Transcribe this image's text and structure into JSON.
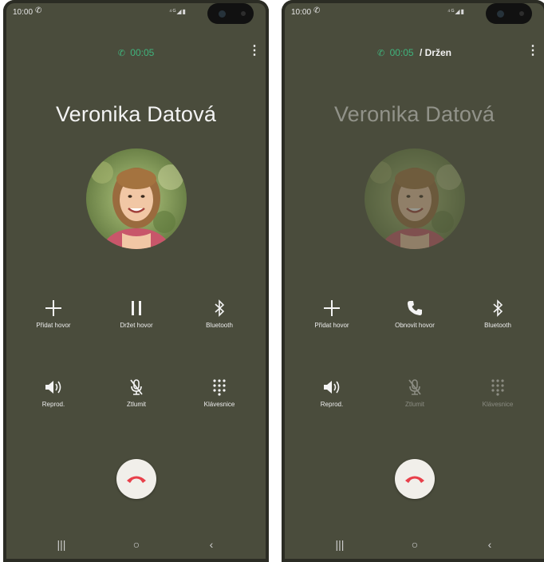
{
  "screens": [
    {
      "status": {
        "time": "10:00",
        "icons_text": "⁴ᴳ◢▮"
      },
      "call": {
        "timer": "00:05",
        "held_text": ""
      },
      "contact": {
        "name": "Veronika Datová"
      },
      "controls": {
        "add_call": "Přidat hovor",
        "hold": "Držet hovor",
        "bluetooth": "Bluetooth",
        "speaker": "Reprod.",
        "mute": "Ztlumit",
        "keypad": "Klávesnice"
      }
    },
    {
      "status": {
        "time": "10:00",
        "icons_text": "⁴ᴳ◢▮"
      },
      "call": {
        "timer": "00:05",
        "held_text": "/ Držen"
      },
      "contact": {
        "name": "Veronika Datová"
      },
      "controls": {
        "add_call": "Přidat hovor",
        "resume": "Obnovit hovor",
        "bluetooth": "Bluetooth",
        "speaker": "Reprod.",
        "mute": "Ztlumit",
        "keypad": "Klávesnice"
      }
    }
  ],
  "icons": {
    "call_active": "phone-icon",
    "more": "more-vertical-icon",
    "add": "plus-icon",
    "hold": "pause-icon",
    "resume": "phone-icon",
    "bluetooth": "bluetooth-icon",
    "speaker": "speaker-icon",
    "mute": "mic-off-icon",
    "keypad": "dialpad-icon",
    "end": "end-call-icon"
  },
  "colors": {
    "background": "#4a4c3c",
    "accent_green": "#3fb37c",
    "end_call_red": "#e8404a",
    "end_call_bg": "#f1efea"
  }
}
